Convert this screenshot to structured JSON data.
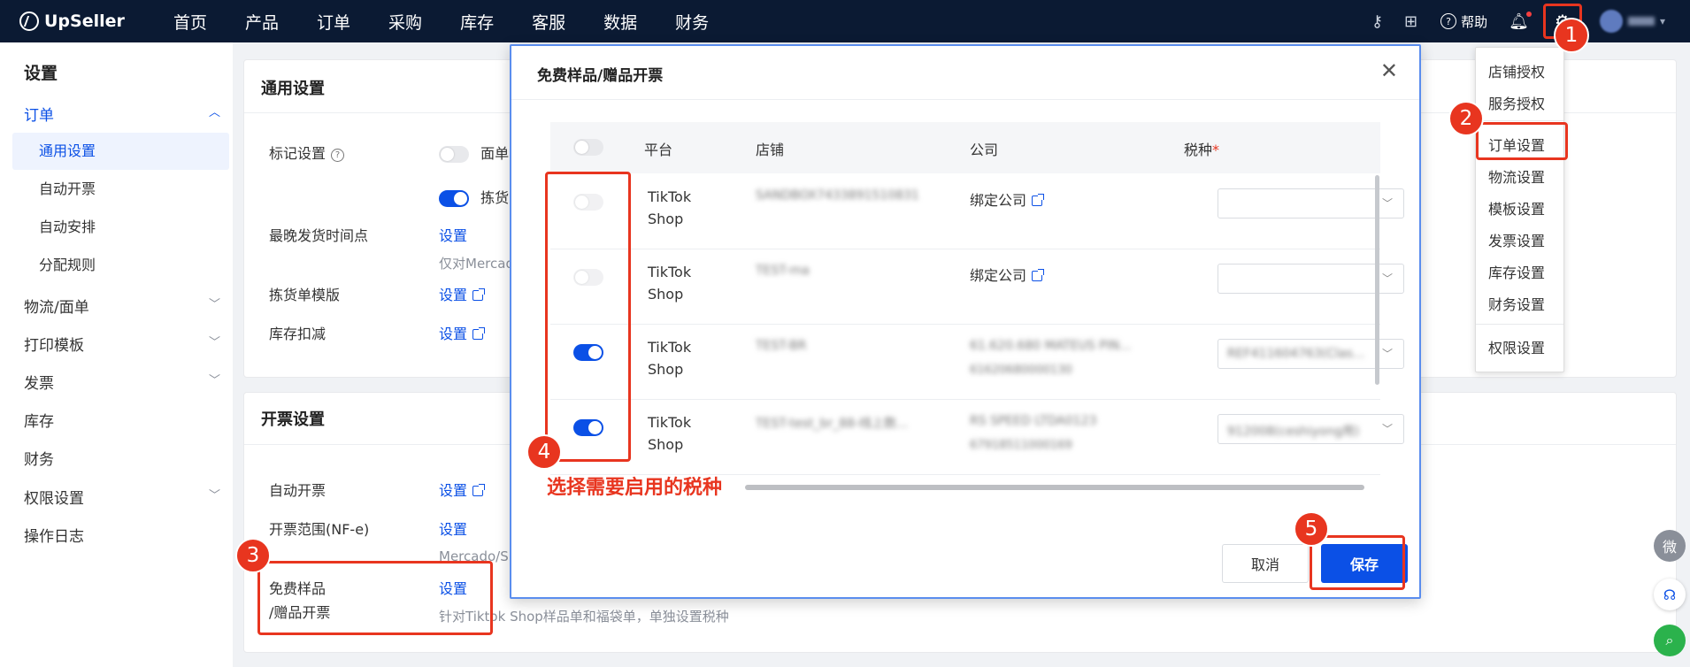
{
  "brand": {
    "name": "UpSeller"
  },
  "nav": [
    "首页",
    "产品",
    "订单",
    "采购",
    "库存",
    "客服",
    "数据",
    "财务"
  ],
  "topbar": {
    "help_label": "帮助",
    "user_name": "测试"
  },
  "settings_menu": {
    "items": [
      "店铺授权",
      "服务授权",
      "订单设置",
      "物流设置",
      "模板设置",
      "发票设置",
      "库存设置",
      "财务设置",
      "权限设置"
    ],
    "active_index": 2
  },
  "sidebar": {
    "title": "设置",
    "order_group": "订单",
    "order_items": [
      "通用设置",
      "自动开票",
      "自动安排",
      "分配规则"
    ],
    "active_item": "通用设置",
    "groups": [
      "物流/面单",
      "打印模板",
      "发票",
      "库存",
      "财务",
      "权限设置",
      "操作日志"
    ]
  },
  "general_card": {
    "title": "通用设置",
    "mark_label": "标记设置",
    "mark_opt1": "面单",
    "mark_opt2": "拣货",
    "latest_ship_label": "最晚发货时间点",
    "latest_ship_link": "设置",
    "latest_ship_note": "仅对Mercado",
    "picklist_label": "拣货单模版",
    "picklist_link": "设置",
    "stock_label": "库存扣减",
    "stock_link": "设置"
  },
  "invoice_card": {
    "title": "开票设置",
    "auto_label": "自动开票",
    "auto_link": "设置",
    "range_label": "开票范围(NF-e)",
    "range_link": "设置",
    "range_note": "Mercado/S",
    "free_label_1": "免费样品",
    "free_label_2": "/赠品开票",
    "free_link": "设置",
    "free_note": "针对Tiktok Shop样品单和福袋单，单独设置税种"
  },
  "modal": {
    "title": "免费样品/赠品开票",
    "headers": {
      "platform": "平台",
      "store": "店铺",
      "company": "公司",
      "tax": "税种",
      "required_mark": "*"
    },
    "rows": [
      {
        "enabled": false,
        "platform_1": "TikTok",
        "platform_2": "Shop",
        "store": "SANDBOX7433891510831",
        "company_link": "绑定公司",
        "company_name": "",
        "company_id": "",
        "tax": ""
      },
      {
        "enabled": false,
        "platform_1": "TikTok",
        "platform_2": "Shop",
        "store": "TEST-ma",
        "company_link": "绑定公司",
        "company_name": "",
        "company_id": "",
        "tax": ""
      },
      {
        "enabled": true,
        "platform_1": "TikTok",
        "platform_2": "Shop",
        "store": "TEST-BR",
        "company_link": "",
        "company_name": "61.620.680 MATEUS PIN...",
        "company_id": "61620680000130",
        "tax": "REF411604763(Clas..."
      },
      {
        "enabled": true,
        "platform_1": "TikTok",
        "platform_2": "Shop",
        "store": "TEST-test_br_88-线上数...",
        "company_link": "",
        "company_name": "RS SPEED LTDA0123",
        "company_id": "67918511000169",
        "tax": "912008(ceshiyong用)"
      }
    ],
    "cancel_label": "取消",
    "save_label": "保存"
  },
  "annotations": {
    "badges": [
      "1",
      "2",
      "3",
      "4",
      "5"
    ],
    "tax_hint": "选择需要启用的税种"
  },
  "floating": {
    "wei": "微"
  },
  "colors": {
    "primary": "#0b50e6",
    "annotation": "#e8351f",
    "nav_bg": "#0b1a33"
  }
}
